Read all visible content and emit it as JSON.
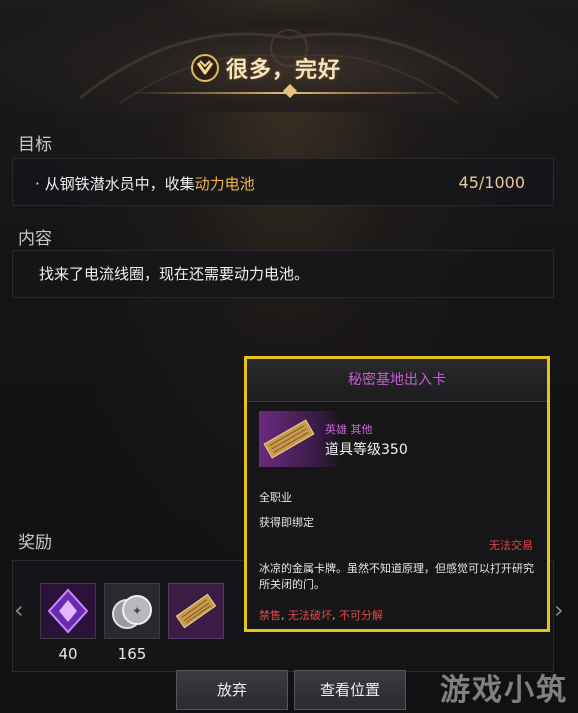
{
  "header": {
    "title": "很多，完好",
    "icon": "quest-emblem-icon"
  },
  "objective": {
    "label": "目标",
    "bullet": "·",
    "text_prefix": "从钢铁潜水员中，收集",
    "text_highlight": "动力电池",
    "progress": "45/1000"
  },
  "content": {
    "label": "内容",
    "text": "找来了电流线圈，现在还需要动力电池。"
  },
  "rewards": {
    "label": "奖励",
    "items": [
      {
        "icon": "purple-crystal-icon",
        "count": "40"
      },
      {
        "icon": "silver-coins-icon",
        "count": "165"
      },
      {
        "icon": "access-card-icon",
        "count": ""
      }
    ]
  },
  "tooltip": {
    "title": "秘密基地出入卡",
    "grade": "英雄 其他",
    "item_level": "道具等级350",
    "class": "全职业",
    "binding": "获得即绑定",
    "trade": "无法交易",
    "description": "冰凉的金属卡牌。虽然不知道原理，但感觉可以打开研究所关闭的门。",
    "flag_1": "禁售",
    "sep_1": ", ",
    "flag_2": "无法破坏",
    "sep_2": ", ",
    "flag_3": "不可分解"
  },
  "buttons": {
    "abandon": "放弃",
    "locate": "查看位置"
  },
  "watermark": "游戏小筑",
  "colors": {
    "gold": "#e5c21c",
    "highlight": "#f0b44a",
    "hero": "#c866d6",
    "warning": "#e24848"
  }
}
